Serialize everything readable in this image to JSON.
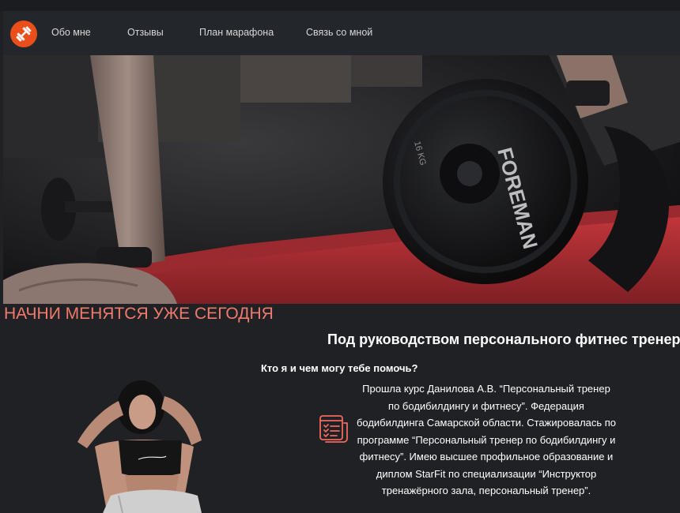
{
  "nav": {
    "logo_icon": "dumbbell-icon",
    "accent_color": "#e94e1b",
    "links": [
      {
        "label": "Обо мне"
      },
      {
        "label": "Отзывы"
      },
      {
        "label": "План марафона"
      },
      {
        "label": "Связь со мной"
      }
    ]
  },
  "hero": {
    "image": "hero-dumbbell-photo",
    "dumbbell_brand": "FOREMAN",
    "dumbbell_weight": "16 KG"
  },
  "main": {
    "headline": "НАЧНИ МЕНЯТСЯ УЖЕ СЕГОДНЯ",
    "headline_color": "#f27a6c",
    "subheadline": "Под руководством персонального фитнес тренера",
    "question": "Кто я и чем могу тебе помочь?",
    "cert_icon": "certificate-checklist-icon",
    "bio": "Прошла курс Данилова А.В. “Персональный тренер по бодибилдингу и фитнесу”. Федерация бодибилдинга Самарской области. Стажировалась по программе “Персональный тренер по бодибилдингу и фитнесу”. Имею высшее профильное образование и диплом StarFit по специализации “Инструктор тренажёрного зала, персональный тренер”."
  }
}
